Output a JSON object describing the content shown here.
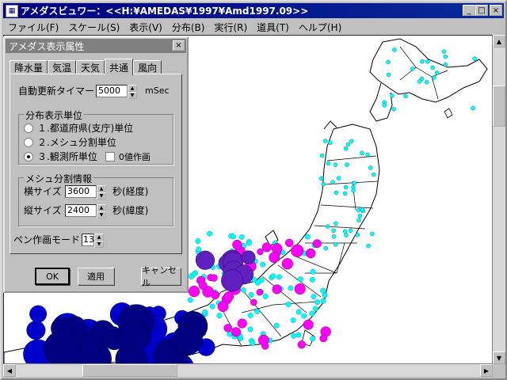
{
  "window": {
    "title": "アメダスビュワー：<<H:¥AMEDAS¥1997¥Amd1997.09>>",
    "minimize": "_",
    "maximize": "□",
    "close": "×"
  },
  "menu": [
    {
      "label": "ファイル(F)"
    },
    {
      "label": "スケール(S)"
    },
    {
      "label": "表示(V)"
    },
    {
      "label": "分布(B)"
    },
    {
      "label": "実行(R)"
    },
    {
      "label": "道具(T)"
    },
    {
      "label": "ヘルプ(H)"
    }
  ],
  "dialog": {
    "title": "アメダス表示属性",
    "close": "×",
    "tabs": [
      "降水量",
      "気温",
      "天気",
      "共通",
      "風向"
    ],
    "active_tab": "共通",
    "timer_label": "自動更新タイマー",
    "timer_value": "5000",
    "timer_unit": "mSec",
    "dist_group": "分布表示単位",
    "radio1": "１.都道府県(支庁)単位",
    "radio2": "２.メシュ分割単位",
    "radio3": "３.観測所単位",
    "zero_check": "0値作画",
    "mesh_group": "メシュ分割情報",
    "w_label": "横サイズ",
    "w_value": "3600",
    "w_unit": "秒(経度)",
    "h_label": "縦サイズ",
    "h_value": "2400",
    "h_unit": "秒(緯度)",
    "pen_label": "ペン作画モード",
    "pen_value": "13",
    "ok": "OK",
    "apply": "適用",
    "cancel": "キャンセル"
  },
  "colors": {
    "titlebar": "#000080",
    "station_cyan": "#00ffff",
    "rain_magenta": "#ff00ff",
    "rain_blue": "#0000cc",
    "rain_navy": "#000080"
  }
}
